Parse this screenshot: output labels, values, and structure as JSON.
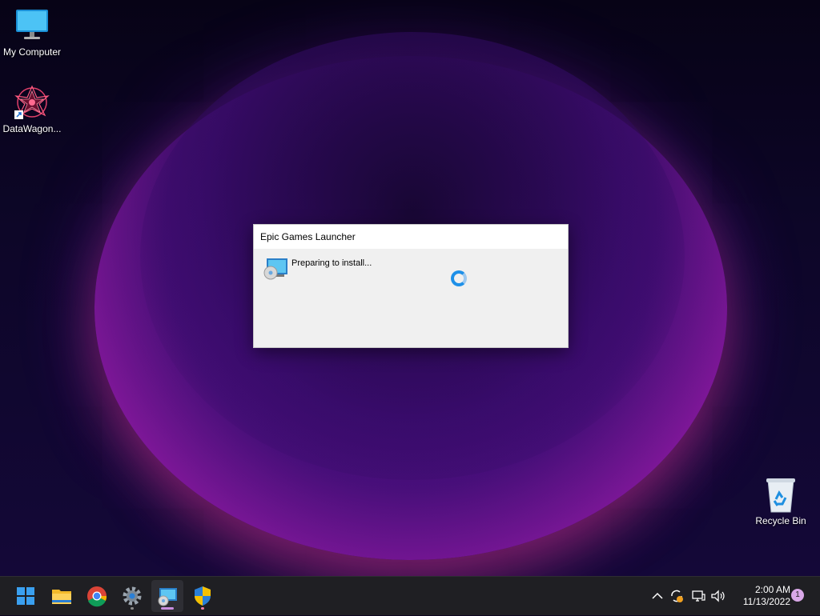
{
  "desktop": {
    "icons": [
      {
        "label": "My Computer",
        "icon": "monitor-icon"
      },
      {
        "label": "DataWagon...",
        "icon": "datawagon-app-icon"
      },
      {
        "label": "Recycle Bin",
        "icon": "recycle-bin-icon"
      }
    ]
  },
  "dialog": {
    "title": "Epic Games Launcher",
    "status": "Preparing to install...",
    "icon": "installer-icon",
    "spinner": "loading-spinner"
  },
  "taskbar": {
    "apps": [
      {
        "name": "Start",
        "icon": "windows-start-icon"
      },
      {
        "name": "File Explorer",
        "icon": "folder-icon"
      },
      {
        "name": "Google Chrome",
        "icon": "chrome-icon"
      },
      {
        "name": "Settings",
        "icon": "gear-icon"
      },
      {
        "name": "Installer",
        "icon": "installer-icon"
      },
      {
        "name": "Windows Security",
        "icon": "shield-icon"
      }
    ],
    "tray": {
      "icons": [
        "chevron-up-icon",
        "sync-icon",
        "network-icon",
        "volume-icon"
      ],
      "time": "2:00 AM",
      "date": "11/13/2022",
      "notification_count": "1"
    }
  },
  "colors": {
    "accent": "#1e90e8",
    "taskbar_bg": "#1f1f23",
    "dialog_bg": "#f0f0f0"
  }
}
